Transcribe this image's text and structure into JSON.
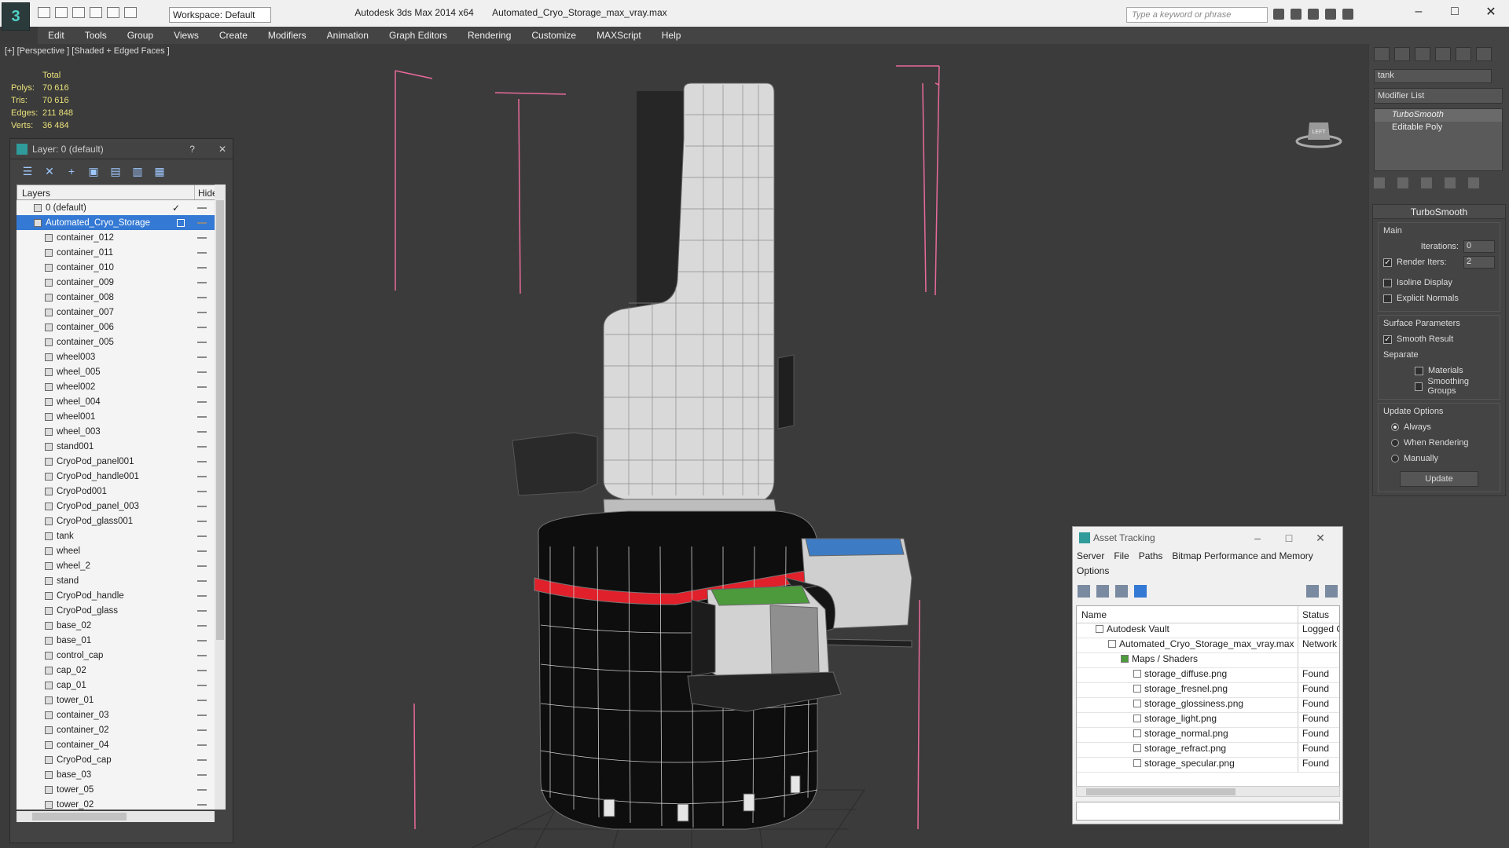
{
  "app": {
    "title": "Autodesk 3ds Max  2014 x64",
    "file": "Automated_Cryo_Storage_max_vray.max",
    "workspace": "Workspace: Default",
    "search_placeholder": "Type a keyword or phrase"
  },
  "menu": [
    "Edit",
    "Tools",
    "Group",
    "Views",
    "Create",
    "Modifiers",
    "Animation",
    "Graph Editors",
    "Rendering",
    "Customize",
    "MAXScript",
    "Help"
  ],
  "viewport": {
    "label": "[+] [Perspective ] [Shaded + Edged Faces ]",
    "stats": {
      "header": "Total",
      "polys_label": "Polys:",
      "polys": "70 616",
      "tris_label": "Tris:",
      "tris": "70 616",
      "edges_label": "Edges:",
      "edges": "211 848",
      "verts_label": "Verts:",
      "verts": "36 484"
    },
    "viewcube_label": "LEFT"
  },
  "layer_panel": {
    "title": "Layer: 0 (default)",
    "help": "?",
    "col_layers": "Layers",
    "col_hide": "Hide",
    "default_layer": "0 (default)",
    "selected_layer": "Automated_Cryo_Storage",
    "objects": [
      "container_012",
      "container_011",
      "container_010",
      "container_009",
      "container_008",
      "container_007",
      "container_006",
      "container_005",
      "wheel003",
      "wheel_005",
      "wheel002",
      "wheel_004",
      "wheel001",
      "wheel_003",
      "stand001",
      "CryoPod_panel001",
      "CryoPod_handle001",
      "CryoPod001",
      "CryoPod_panel_003",
      "CryoPod_glass001",
      "tank",
      "wheel",
      "wheel_2",
      "stand",
      "CryoPod_handle",
      "CryoPod_glass",
      "base_02",
      "base_01",
      "control_cap",
      "cap_02",
      "cap_01",
      "tower_01",
      "container_03",
      "container_02",
      "container_04",
      "CryoPod_cap",
      "base_03",
      "tower_05",
      "tower_02"
    ]
  },
  "command_panel": {
    "object_name": "tank",
    "modifier_list": "Modifier List",
    "stack": [
      "TurboSmooth",
      "Editable Poly"
    ],
    "rollout_title": "TurboSmooth",
    "main_label": "Main",
    "iterations_label": "Iterations:",
    "iterations": "0",
    "render_iters_label": "Render Iters:",
    "render_iters": "2",
    "isoline_label": "Isoline Display",
    "explicit_label": "Explicit Normals",
    "surface_label": "Surface Parameters",
    "smooth_label": "Smooth Result",
    "separate_label": "Separate",
    "materials_label": "Materials",
    "smoothing_groups_label": "Smoothing Groups",
    "update_options_label": "Update Options",
    "always_label": "Always",
    "when_rendering_label": "When Rendering",
    "manually_label": "Manually",
    "update_button": "Update"
  },
  "asset_tracking": {
    "title": "Asset Tracking",
    "menu": [
      "Server",
      "File",
      "Paths",
      "Bitmap Performance and Memory",
      "Options"
    ],
    "col_name": "Name",
    "col_status": "Status",
    "rows": [
      {
        "name": "Autodesk Vault",
        "status": "Logged O"
      },
      {
        "name": "Automated_Cryo_Storage_max_vray.max",
        "status": "Network"
      },
      {
        "name": "Maps / Shaders",
        "status": ""
      },
      {
        "name": "storage_diffuse.png",
        "status": "Found"
      },
      {
        "name": "storage_fresnel.png",
        "status": "Found"
      },
      {
        "name": "storage_glossiness.png",
        "status": "Found"
      },
      {
        "name": "storage_light.png",
        "status": "Found"
      },
      {
        "name": "storage_normal.png",
        "status": "Found"
      },
      {
        "name": "storage_refract.png",
        "status": "Found"
      },
      {
        "name": "storage_specular.png",
        "status": "Found"
      }
    ]
  },
  "colors": {
    "selection": "#3479d4",
    "stats": "#e8e07a",
    "bbox": "#e86a9a",
    "band": "#e0202a"
  }
}
